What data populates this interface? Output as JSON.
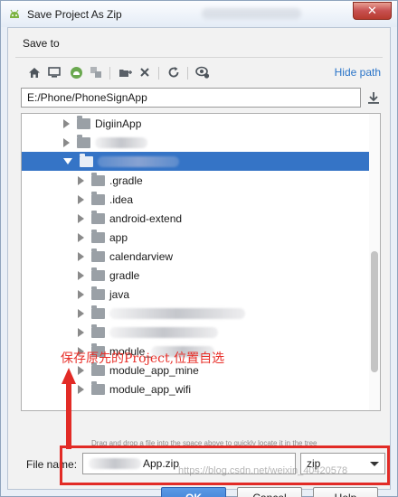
{
  "window": {
    "title": "Save Project As Zip",
    "close_glyph": "✕"
  },
  "header": {
    "save_to_label": "Save to"
  },
  "toolbar": {
    "icons": [
      "home-icon",
      "desktop-icon",
      "project-icon",
      "module-icon",
      "new-folder-icon",
      "delete-icon",
      "refresh-icon",
      "show-hidden-icon"
    ],
    "hide_path_label": "Hide path"
  },
  "path": {
    "value": "E:/Phone/PhoneSignApp"
  },
  "tree": {
    "items": [
      {
        "label": "DigiinApp",
        "level": 0,
        "expanded": false
      },
      {
        "label": "",
        "level": 0,
        "expanded": false,
        "redacted": true
      },
      {
        "label": "",
        "level": 0,
        "expanded": true,
        "selected": true,
        "redacted": true
      },
      {
        "label": ".gradle",
        "level": 1
      },
      {
        "label": ".idea",
        "level": 1
      },
      {
        "label": "android-extend",
        "level": 1
      },
      {
        "label": "app",
        "level": 1
      },
      {
        "label": "calendarview",
        "level": 1
      },
      {
        "label": "gradle",
        "level": 1
      },
      {
        "label": "java",
        "level": 1
      },
      {
        "label": "",
        "level": 1,
        "redacted": true
      },
      {
        "label": "",
        "level": 1,
        "redacted": true
      },
      {
        "label": "module_",
        "level": 1
      },
      {
        "label": "module_app_mine",
        "level": 1
      },
      {
        "label": "module_app_wifi",
        "level": 1
      }
    ],
    "drop_hint": "Drag and drop a file into the space above to quickly locate it in the tree"
  },
  "annotation": {
    "text": "保存原先的Project,位置自选",
    "color": "#e8302a"
  },
  "filename": {
    "label": "File name:",
    "value": "App.zip",
    "type_value": "zip"
  },
  "buttons": {
    "ok": "OK",
    "cancel": "Cancel",
    "help": "Help"
  },
  "watermark": {
    "text": "https://blog.csdn.net/weixin_40420578"
  },
  "colors": {
    "accent": "#3574c6",
    "link": "#2a74c8",
    "highlight": "#e22b26"
  }
}
